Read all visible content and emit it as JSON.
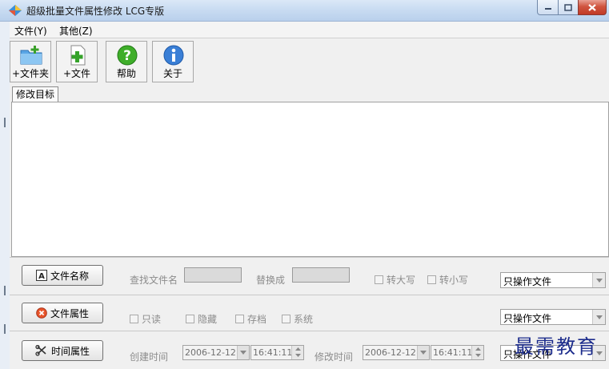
{
  "window": {
    "title": "超级批量文件属性修改 LCG专版"
  },
  "menu": {
    "items": [
      {
        "label": "文件(Y)"
      },
      {
        "label": "其他(Z)"
      }
    ]
  },
  "toolbar": {
    "buttons": [
      {
        "label": "+文件夹",
        "icon": "add-folder-icon"
      },
      {
        "label": "+文件",
        "icon": "add-file-icon"
      },
      {
        "label": "帮助",
        "icon": "help-icon"
      },
      {
        "label": "关于",
        "icon": "info-icon"
      }
    ]
  },
  "tabs": {
    "active": "修改目标"
  },
  "name_row": {
    "button_label": "文件名称",
    "find_label": "查找文件名",
    "find_value": "",
    "replace_label": "替换成",
    "replace_value": "",
    "upper_label": "转大写",
    "lower_label": "转小写",
    "scope": "只操作文件"
  },
  "attr_row": {
    "button_label": "文件属性",
    "readonly_label": "只读",
    "hidden_label": "隐藏",
    "archive_label": "存档",
    "system_label": "系统",
    "scope": "只操作文件"
  },
  "time_row": {
    "button_label": "时间属性",
    "created_label": "创建时间",
    "created_date": "2006-12-12",
    "created_time": "16:41:11",
    "modified_label": "修改时间",
    "modified_date": "2006-12-12",
    "modified_time": "16:41:11",
    "scope": "只操作文件"
  },
  "watermark": "最需教育"
}
